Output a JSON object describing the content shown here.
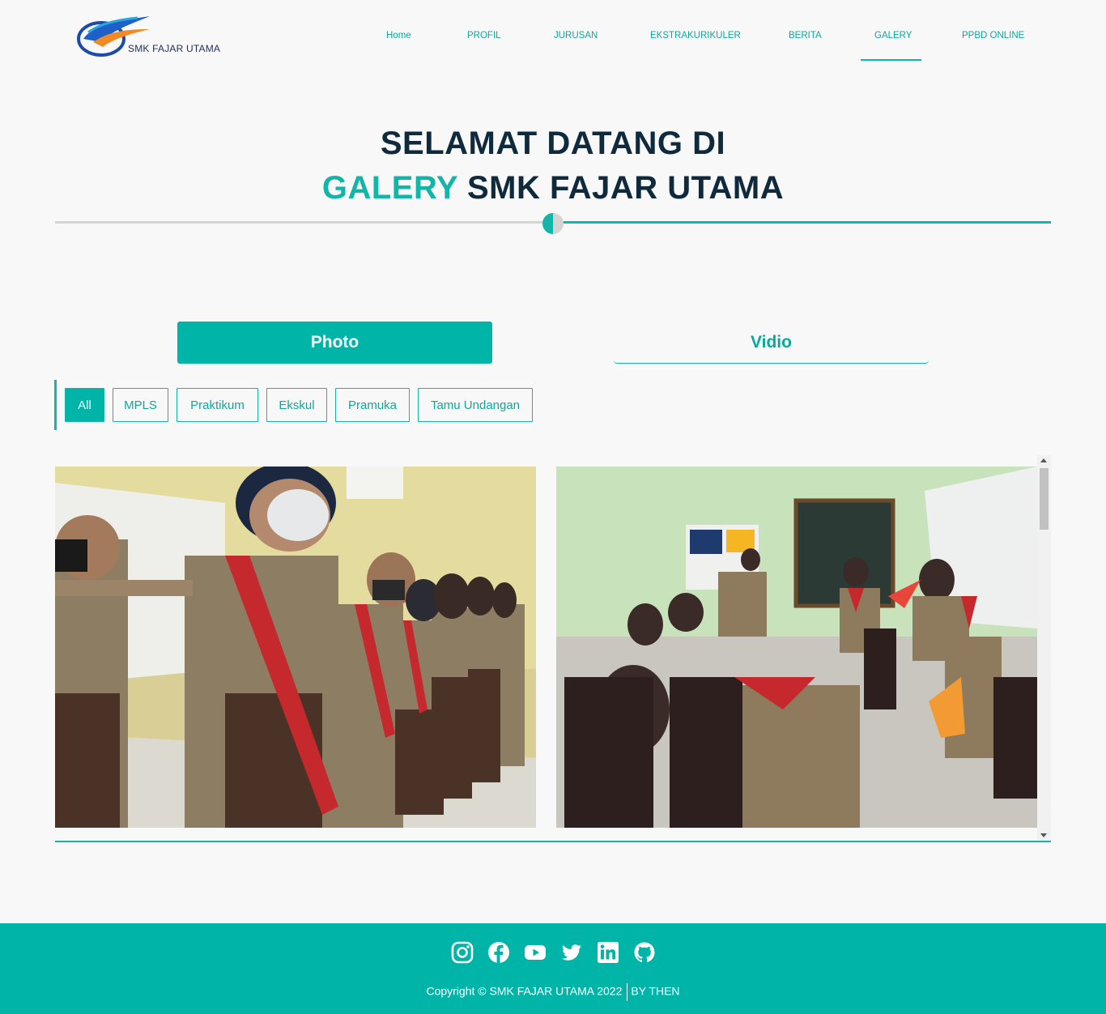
{
  "brand": {
    "name": "SMK FAJAR UTAMA",
    "colors": {
      "primary": "#00b5a7",
      "navy": "#0f2a3d"
    }
  },
  "nav": {
    "items": [
      {
        "label": "Home"
      },
      {
        "label": "PROFIL"
      },
      {
        "label": "JURUSAN"
      },
      {
        "label": "EKSTRAKURIKULER"
      },
      {
        "label": "BERITA"
      },
      {
        "label": "GALERY",
        "active": true
      },
      {
        "label": "PPBD ONLINE"
      }
    ]
  },
  "hero": {
    "line1": "SELAMAT DATANG DI",
    "accent": "GALERY",
    "line2_rest": " SMK FAJAR UTAMA"
  },
  "tabs": {
    "photo": "Photo",
    "video": "Vidio",
    "active": "photo"
  },
  "filters": {
    "items": [
      "All",
      "MPLS",
      "Praktikum",
      "Ekskul",
      "Pramuka",
      "Tamu Undangan"
    ],
    "active": "All"
  },
  "footer": {
    "copyright": "Copyright © SMK FAJAR UTAMA 2022",
    "by": "BY THEN",
    "social_icons": [
      "instagram-icon",
      "facebook-icon",
      "youtube-icon",
      "twitter-icon",
      "linkedin-icon",
      "github-icon"
    ]
  }
}
